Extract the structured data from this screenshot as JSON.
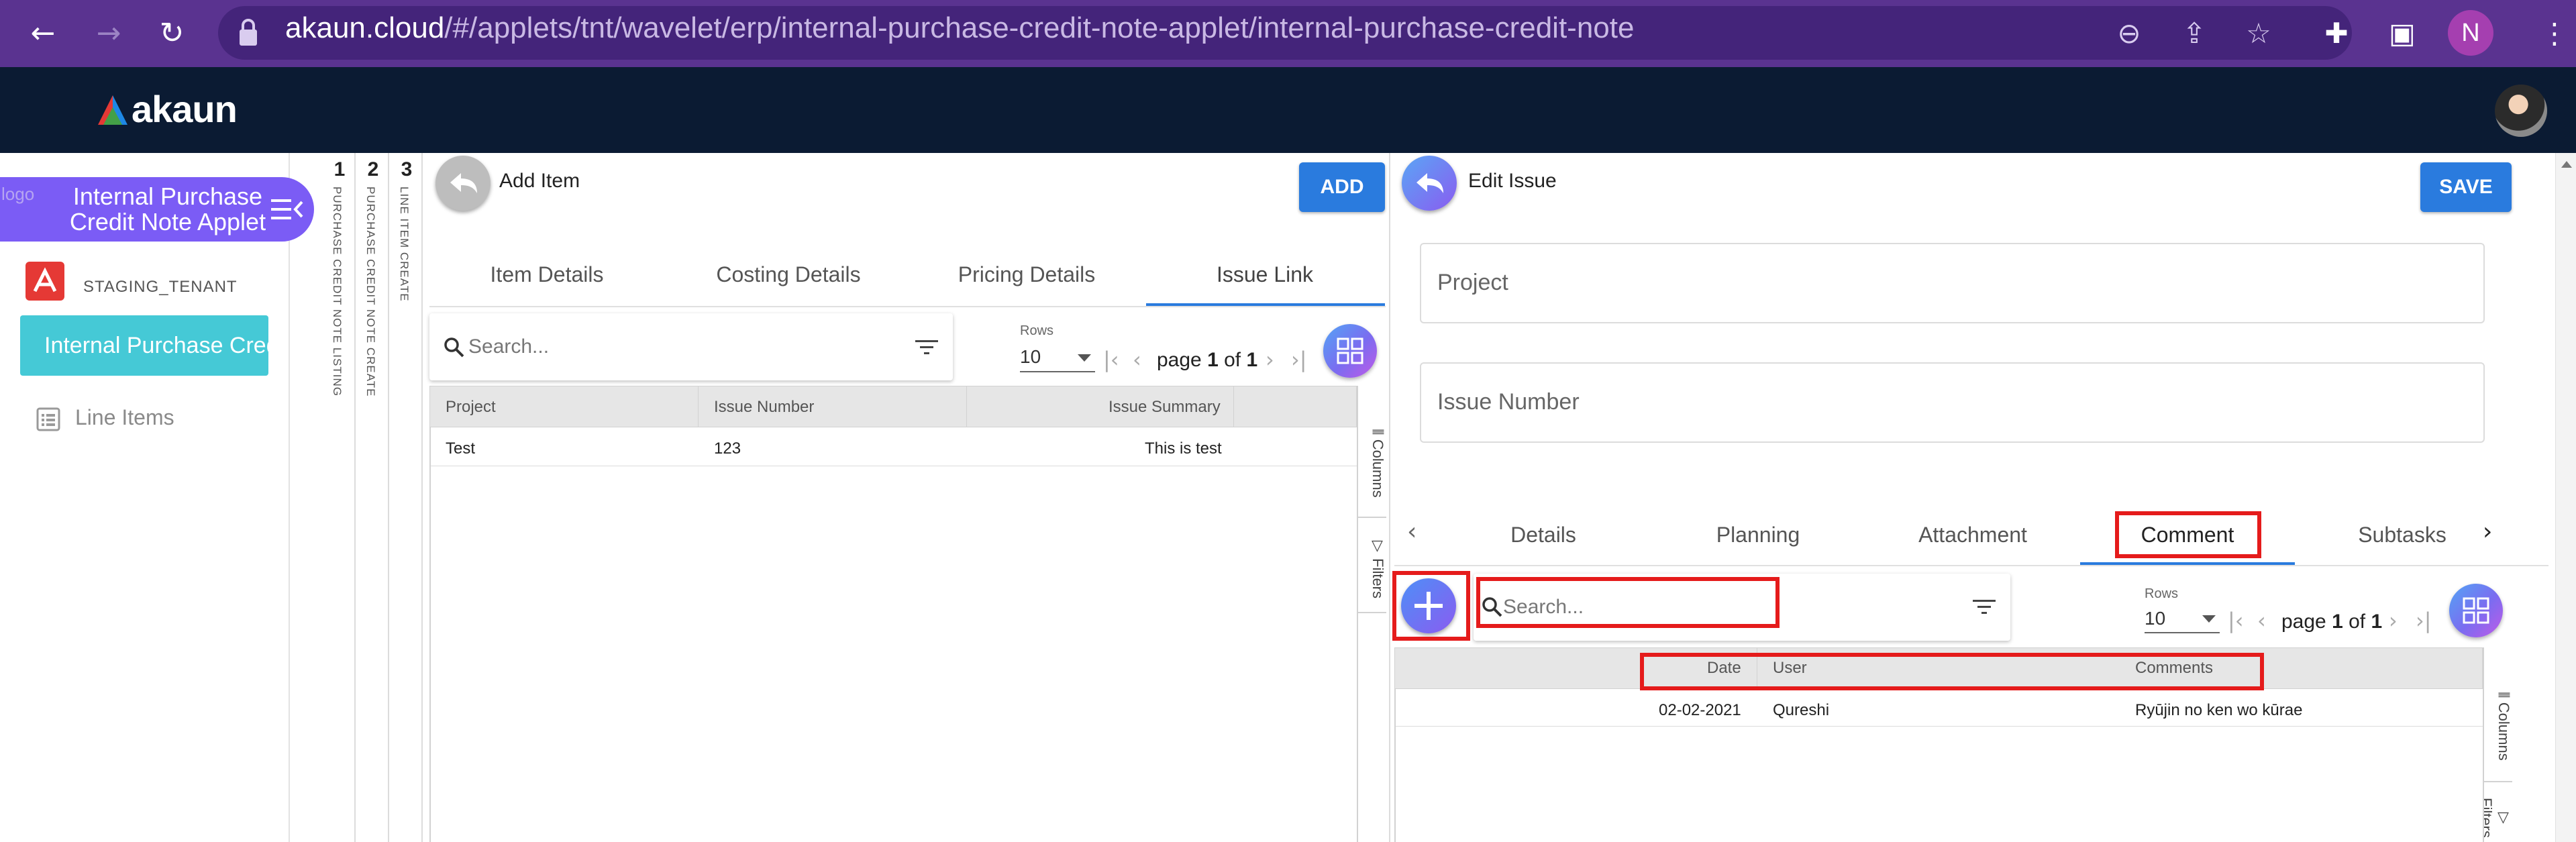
{
  "browser": {
    "url_host": "akaun.cloud",
    "url_path": "/#/applets/tnt/wavelet/erp/internal-purchase-credit-note-applet/internal-purchase-credit-note",
    "profile_initial": "N"
  },
  "app": {
    "brand": "akaun"
  },
  "sidebar": {
    "applet_logo_alt": "logo",
    "applet_title": "Internal Purchase Credit Note Applet",
    "tenant": "STAGING_TENANT",
    "active_item": "Internal Purchase Credit Note",
    "items": [
      {
        "label": "Line Items",
        "icon": "list-icon"
      }
    ]
  },
  "breadcrumbs": [
    {
      "num": "1",
      "label": "PURCHASE CREDIT NOTE LISTING"
    },
    {
      "num": "2",
      "label": "PURCHASE CREDIT NOTE CREATE"
    },
    {
      "num": "3",
      "label": "LINE ITEM CREATE"
    }
  ],
  "add_item": {
    "title": "Add Item",
    "add_label": "ADD",
    "tabs": [
      "Item Details",
      "Costing Details",
      "Pricing Details",
      "Issue Link"
    ],
    "active_tab": "Issue Link",
    "search_placeholder": "Search...",
    "rows_label": "Rows",
    "rows_value": "10",
    "pager": {
      "page_word": "page",
      "page": "1",
      "of_word": "of",
      "total": "1"
    },
    "columns": [
      "Project",
      "Issue Number",
      "Issue Summary"
    ],
    "rows": [
      {
        "project": "Test",
        "issue_number": "123",
        "issue_summary": "This is test"
      }
    ],
    "side_tabs": [
      "Columns",
      "Filters"
    ]
  },
  "edit_issue": {
    "title": "Edit Issue",
    "save_label": "SAVE",
    "project_placeholder": "Project",
    "issue_number_placeholder": "Issue Number",
    "tabs": [
      "Details",
      "Planning",
      "Attachment",
      "Comment",
      "Subtasks"
    ],
    "active_tab": "Comment",
    "search_placeholder": "Search...",
    "rows_label": "Rows",
    "rows_value": "10",
    "pager": {
      "page_word": "page",
      "page": "1",
      "of_word": "of",
      "total": "1"
    },
    "columns": [
      "Date",
      "User",
      "Comments"
    ],
    "rows": [
      {
        "date": "02-02-2021",
        "user": "Qureshi",
        "comment": "Ryūjin no ken wo kūrae"
      }
    ],
    "side_tabs": [
      "Columns",
      "Filters"
    ]
  },
  "colors": {
    "browser_bar": "#5a3390",
    "app_header": "#0b1b33",
    "applet_pill": "#7b5cf5",
    "active_menu": "#45c9d6",
    "primary_button": "#2a7bde",
    "highlight": "#e51b1b"
  }
}
